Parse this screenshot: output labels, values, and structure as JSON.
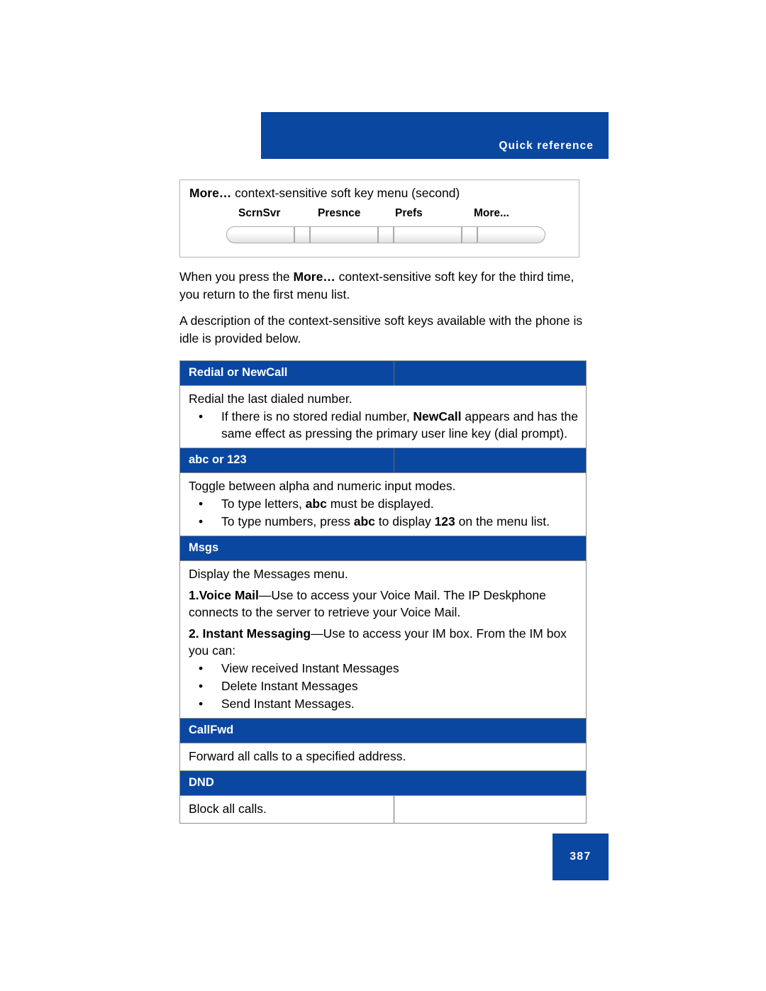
{
  "header": {
    "title": "Quick reference"
  },
  "softkey_figure": {
    "caption_bold": "More…",
    "caption_rest": " context-sensitive soft key menu (second)",
    "keys": [
      "ScrnSvr",
      "Presnce",
      "Prefs",
      "More..."
    ]
  },
  "paragraphs": [
    {
      "segments": [
        {
          "text": "When you press the ",
          "bold": false
        },
        {
          "text": "More…",
          "bold": true
        },
        {
          "text": " context-sensitive soft key for the third time, you return to the first menu list.",
          "bold": false
        }
      ]
    },
    {
      "segments": [
        {
          "text": "A description of the context-sensitive soft keys available with the phone is idle is provided below.",
          "bold": false
        }
      ]
    }
  ],
  "table": {
    "sections": [
      {
        "header": "Redial or NewCall",
        "header_split": true,
        "body_split": false,
        "body": {
          "intro": [
            {
              "segments": [
                {
                  "text": "Redial the last dialed number.",
                  "bold": false
                }
              ]
            }
          ],
          "bullets": [
            {
              "segments": [
                {
                  "text": "If there is no stored redial number, ",
                  "bold": false
                },
                {
                  "text": "NewCall",
                  "bold": true
                },
                {
                  "text": " appears and has the same effect as pressing the primary user line key (dial prompt).",
                  "bold": false
                }
              ]
            }
          ]
        }
      },
      {
        "header": "abc or 123",
        "header_split": true,
        "body_split": false,
        "body": {
          "intro": [
            {
              "segments": [
                {
                  "text": "Toggle between alpha and numeric input modes.",
                  "bold": false
                }
              ]
            }
          ],
          "bullets": [
            {
              "segments": [
                {
                  "text": "To type letters, ",
                  "bold": false
                },
                {
                  "text": "abc",
                  "bold": true
                },
                {
                  "text": " must be displayed.",
                  "bold": false
                }
              ]
            },
            {
              "segments": [
                {
                  "text": "To type numbers, press ",
                  "bold": false
                },
                {
                  "text": "abc",
                  "bold": true
                },
                {
                  "text": " to display ",
                  "bold": false
                },
                {
                  "text": "123",
                  "bold": true
                },
                {
                  "text": " on the menu list.",
                  "bold": false
                }
              ]
            }
          ]
        }
      },
      {
        "header": "Msgs",
        "header_split": false,
        "body_split": false,
        "body": {
          "intro": [
            {
              "segments": [
                {
                  "text": "Display the Messages menu.",
                  "bold": false
                }
              ]
            },
            {
              "segments": [
                {
                  "text": "1.Voice Mail",
                  "bold": true
                },
                {
                  "text": "—Use to access your Voice Mail. The IP Deskphone connects to the server to retrieve your Voice Mail.",
                  "bold": false
                }
              ]
            },
            {
              "segments": [
                {
                  "text": "2. Instant Messaging",
                  "bold": true
                },
                {
                  "text": "—Use to access your IM box. From the IM box you can:",
                  "bold": false
                }
              ]
            }
          ],
          "bullets": [
            {
              "segments": [
                {
                  "text": "View received Instant Messages",
                  "bold": false
                }
              ]
            },
            {
              "segments": [
                {
                  "text": "Delete Instant Messages",
                  "bold": false
                }
              ]
            },
            {
              "segments": [
                {
                  "text": "Send Instant Messages.",
                  "bold": false
                }
              ]
            }
          ]
        }
      },
      {
        "header": "CallFwd",
        "header_split": false,
        "body_split": false,
        "body": {
          "intro": [
            {
              "segments": [
                {
                  "text": "Forward all calls to a specified address.",
                  "bold": false
                }
              ]
            }
          ],
          "bullets": []
        }
      },
      {
        "header": "DND",
        "header_split": false,
        "body_split": true,
        "body": {
          "intro": [
            {
              "segments": [
                {
                  "text": "Block all calls.",
                  "bold": false
                }
              ]
            }
          ],
          "bullets": []
        }
      }
    ]
  },
  "footer": {
    "page_number": "387"
  },
  "colors": {
    "brand_blue": "#0a47a0",
    "rule_gray": "#8d8d8d"
  }
}
